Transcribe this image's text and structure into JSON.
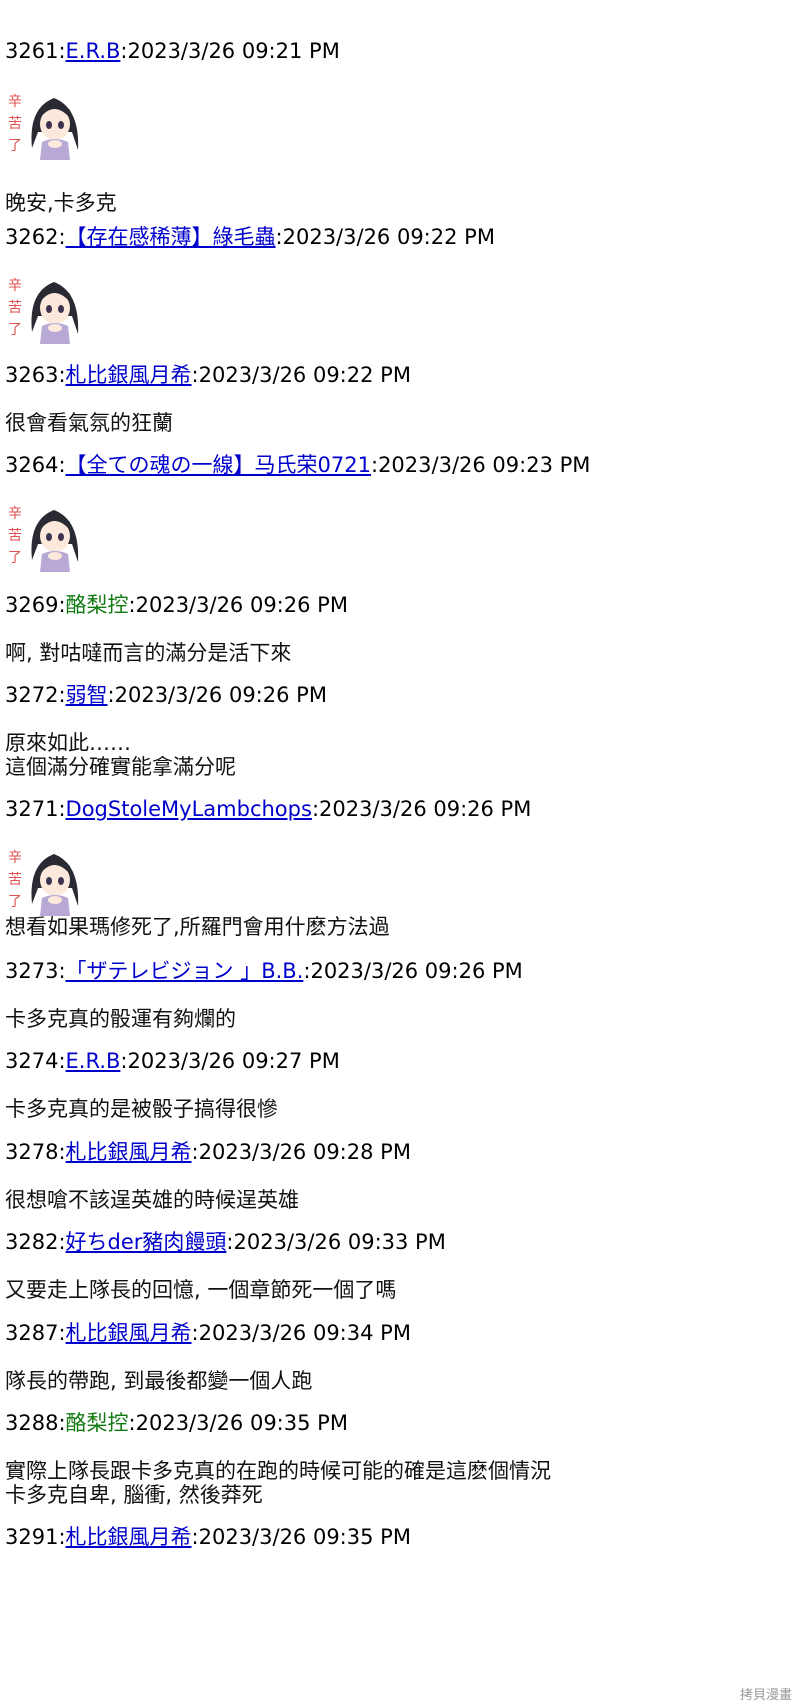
{
  "posts": [
    {
      "num": "3261",
      "user": "E.R.B",
      "date": "2023/3/26 09:21 PM",
      "linked": true,
      "sticker": "kurou-sticker-icon",
      "body": [
        "晚安,卡多克"
      ]
    },
    {
      "num": "3262",
      "user": "【存在感稀薄】綠毛蟲",
      "date": "2023/3/26 09:22 PM",
      "linked": true,
      "sticker": "kurou-sticker-icon",
      "body": []
    },
    {
      "num": "3263",
      "user": "札比銀風月希",
      "date": "2023/3/26 09:22 PM",
      "linked": true,
      "body": [
        "很會看氣氛的狂蘭"
      ]
    },
    {
      "num": "3264",
      "user": "【全ての魂の一線】马氏荣0721",
      "date": "2023/3/26 09:23 PM",
      "linked": true,
      "sticker": "kurou-sticker-icon",
      "body": []
    },
    {
      "num": "3269",
      "user": "酪梨控",
      "date": "2023/3/26 09:26 PM",
      "linked": false,
      "body": [
        "啊, 對咕噠而言的滿分是活下來"
      ]
    },
    {
      "num": "3272",
      "user": "弱智",
      "date": "2023/3/26 09:26 PM",
      "linked": true,
      "body": [
        "原來如此……",
        "這個滿分確實能拿滿分呢"
      ]
    },
    {
      "num": "3271",
      "user": "DogStoleMyLambchops",
      "date": "2023/3/26 09:26 PM",
      "linked": true,
      "sticker": "kurou-sticker-icon",
      "body": [
        "想看如果瑪修死了,所羅門會用什麽方法過"
      ]
    },
    {
      "num": "3273",
      "user": "「ザテレビジョン 」B.B.",
      "date": "2023/3/26 09:26 PM",
      "linked": true,
      "body": [
        "卡多克真的骰運有夠爛的"
      ]
    },
    {
      "num": "3274",
      "user": "E.R.B",
      "date": "2023/3/26 09:27 PM",
      "linked": true,
      "body": [
        "卡多克真的是被骰子搞得很慘"
      ]
    },
    {
      "num": "3278",
      "user": "札比銀風月希",
      "date": "2023/3/26 09:28 PM",
      "linked": true,
      "body": [
        "很想嗆不該逞英雄的時候逞英雄"
      ]
    },
    {
      "num": "3282",
      "user": "好ちder豬肉饅頭",
      "date": "2023/3/26 09:33 PM",
      "linked": true,
      "body": [
        "又要走上隊長的回憶, 一個章節死一個了嗎"
      ]
    },
    {
      "num": "3287",
      "user": "札比銀風月希",
      "date": "2023/3/26 09:34 PM",
      "linked": true,
      "body": [
        "隊長的帶跑, 到最後都變一個人跑"
      ]
    },
    {
      "num": "3288",
      "user": "酪梨控",
      "date": "2023/3/26 09:35 PM",
      "linked": false,
      "body": [
        "實際上隊長跟卡多克真的在跑的時候可能的確是這麽個情況",
        "卡多克自卑, 腦衝, 然後莽死"
      ]
    },
    {
      "num": "3291",
      "user": "札比銀風月希",
      "date": "2023/3/26 09:35 PM",
      "linked": true,
      "body": []
    }
  ],
  "watermark": "拷貝漫畫",
  "colors": {
    "link": "#0000cc",
    "plain_user": "#117a11",
    "text": "#111111"
  }
}
